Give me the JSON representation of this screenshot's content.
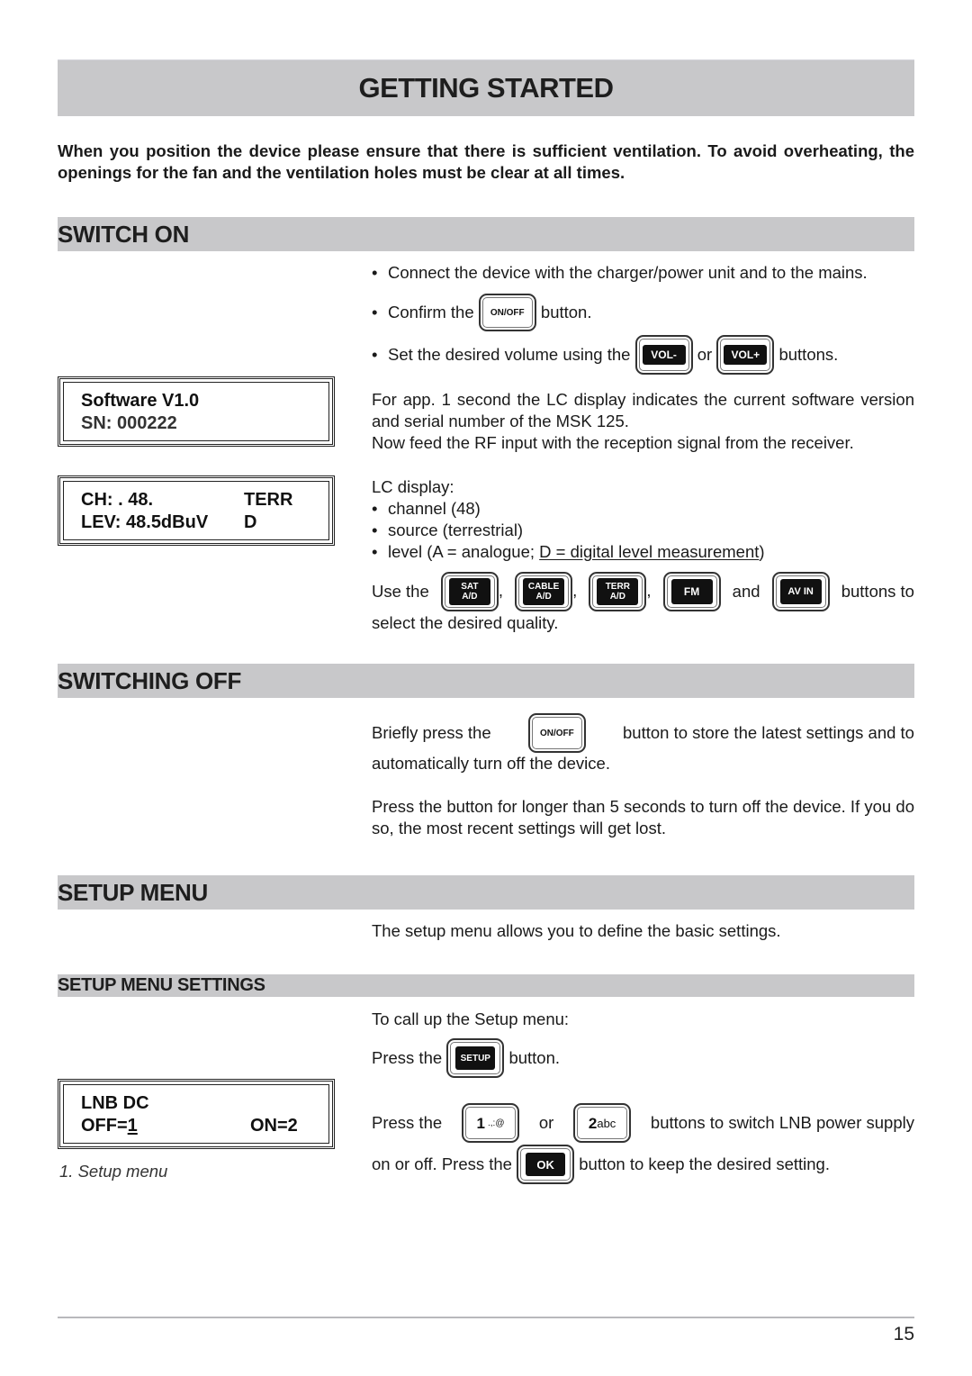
{
  "title": "GETTING STARTED",
  "intro": "When you position the device please ensure that there is sufficient ventilation. To avoid overheating, the openings for the fan and the ventilation holes must be clear at all times.",
  "switch_on": {
    "heading": "SWITCH ON",
    "bullets": {
      "b1": "Connect the device with the charger/power unit and to the mains.",
      "b2_pre": "Confirm the",
      "b2_post": "button.",
      "b3_pre": "Set the desired volume using the",
      "b3_mid": "or",
      "b3_post": "buttons."
    },
    "software_para": "For app. 1 second the LC display indicates the current software version and serial number of the MSK 125.",
    "feed_para": "Now feed the RF input with the reception signal from the receiver.",
    "lc_label": "LC display:",
    "lc_items": {
      "i1": "channel (48)",
      "i2": "source (terrestrial)",
      "i3_pre": "level (A = analogue; ",
      "i3_link": "D = digital level measurement",
      "i3_post": ")"
    },
    "use_pre": "Use the",
    "use_and": "and",
    "use_post": "buttons to",
    "use_line2": "select the desired quality."
  },
  "lcd_software": {
    "line1": "Software V1.0",
    "line2": "SN: 000222"
  },
  "lcd_channel": {
    "ch": "CH: . 48.",
    "src": "TERR",
    "lev": "LEV: 48.5dBuV",
    "mode": "D"
  },
  "switching_off": {
    "heading": "SWITCHING OFF",
    "p1_pre": "Briefly press the",
    "p1_post": "button to store the latest settings and to",
    "p1_line2": "automatically turn off the device.",
    "p2": "Press the button for longer than 5 seconds to turn off the device. If you do so, the most recent settings will get lost."
  },
  "setup_menu": {
    "heading": "SETUP MENU",
    "intro": "The setup menu allows you to define the basic settings."
  },
  "setup_settings": {
    "heading": "SETUP MENU SETTINGS",
    "call_up": "To call up the Setup menu:",
    "press_pre": "Press the",
    "press_post": "button.",
    "lnb_pre": "Press the",
    "lnb_or": "or",
    "lnb_post": "buttons to switch LNB power supply",
    "ok_pre": "on or off. Press the",
    "ok_post": "button to keep the desired setting."
  },
  "lcd_lnb": {
    "line1": "LNB DC",
    "off_label": "OFF=",
    "off_value": "1",
    "on": "ON=2"
  },
  "caption": "1. Setup menu",
  "keys": {
    "onoff": "ON/OFF",
    "vol_minus": "VOL-",
    "vol_plus": "VOL+",
    "sat_top": "SAT",
    "sat_bottom": "A/D",
    "cable_top": "CABLE",
    "cable_bottom": "A/D",
    "terr_top": "TERR",
    "terr_bottom": "A/D",
    "fm": "FM",
    "avin": "AV IN",
    "setup": "SETUP",
    "one_num": "1",
    "one_sym": ".,:@",
    "two_num": "2",
    "two_sym": "abc",
    "ok": "OK"
  },
  "page_number": "15"
}
